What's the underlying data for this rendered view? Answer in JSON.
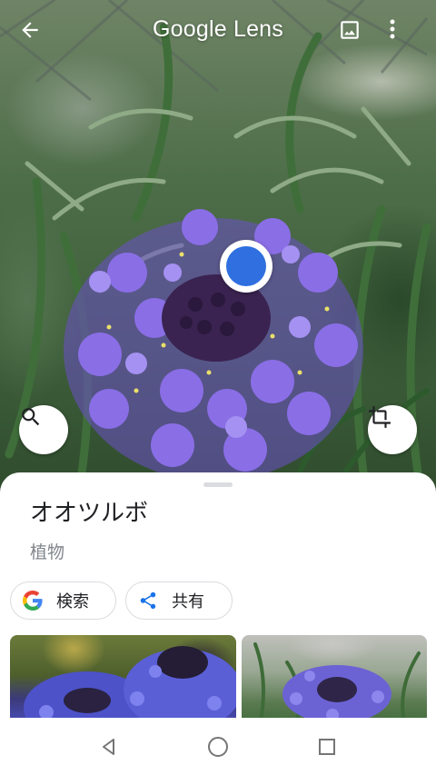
{
  "app": {
    "title": "Google Lens"
  },
  "icons": {
    "back": "arrow-back-icon",
    "gallery": "image-icon",
    "more": "more-vert-icon",
    "search": "search-icon",
    "crop": "crop-icon",
    "google": "google-g-icon",
    "share": "share-icon"
  },
  "result": {
    "title": "オオツルボ",
    "category": "植物"
  },
  "actions": {
    "search_label": "検索",
    "share_label": "共有"
  },
  "colors": {
    "focus_dot": "#2f6fdf",
    "share_icon": "#1a73e8"
  },
  "nav": {
    "back": "nav-back-icon",
    "home": "nav-home-icon",
    "recents": "nav-recents-icon"
  }
}
